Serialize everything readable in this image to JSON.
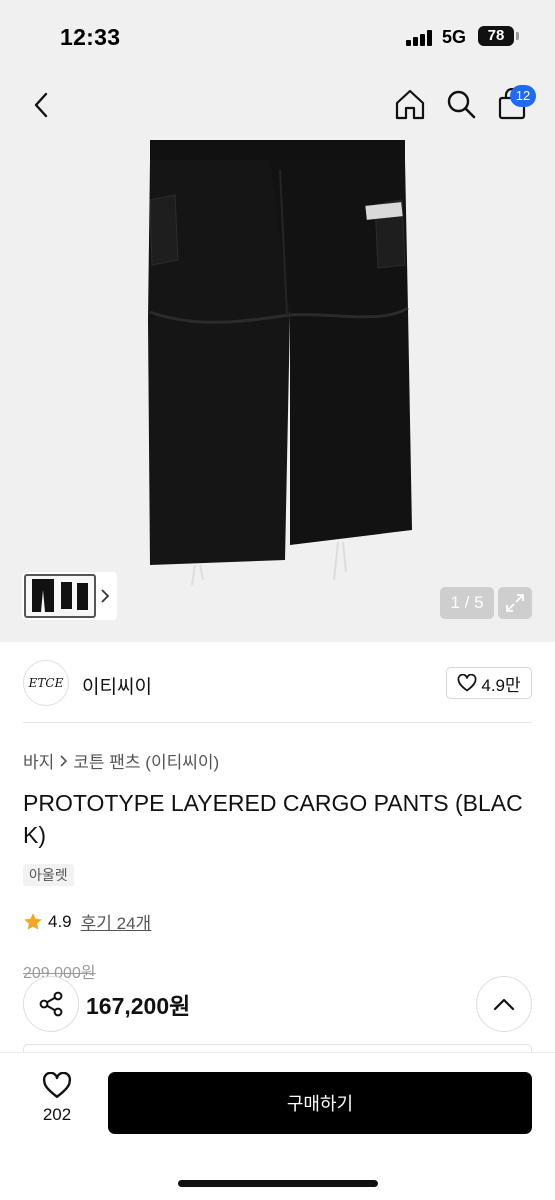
{
  "status_bar": {
    "time": "12:33",
    "network": "5G",
    "battery": "78"
  },
  "header": {
    "icons": {
      "back": "chevron-left-icon",
      "home": "home-icon",
      "search": "search-icon",
      "cart": "shopping-bag-icon"
    },
    "cart_count": "12"
  },
  "gallery": {
    "counter": "1 / 5",
    "expand_icon": "expand-icon"
  },
  "brand": {
    "logo_text": "ETCE",
    "name": "이티씨이",
    "likes": "4.9만"
  },
  "product": {
    "breadcrumb": [
      "바지",
      "코튼 팬츠 (이티씨이)"
    ],
    "title": "PROTOTYPE LAYERED CARGO PANTS (BLACK)",
    "badge": "아울렛",
    "rating": "4.9",
    "reviews": "후기 24개",
    "original_price": "209,000원",
    "sale_price": "167,200원"
  },
  "bottom_bar": {
    "wish_count": "202",
    "buy_label": "구매하기"
  },
  "colors": {
    "accent": "#1f6bf5",
    "star": "#f5a623",
    "buy_button": "#000000"
  }
}
